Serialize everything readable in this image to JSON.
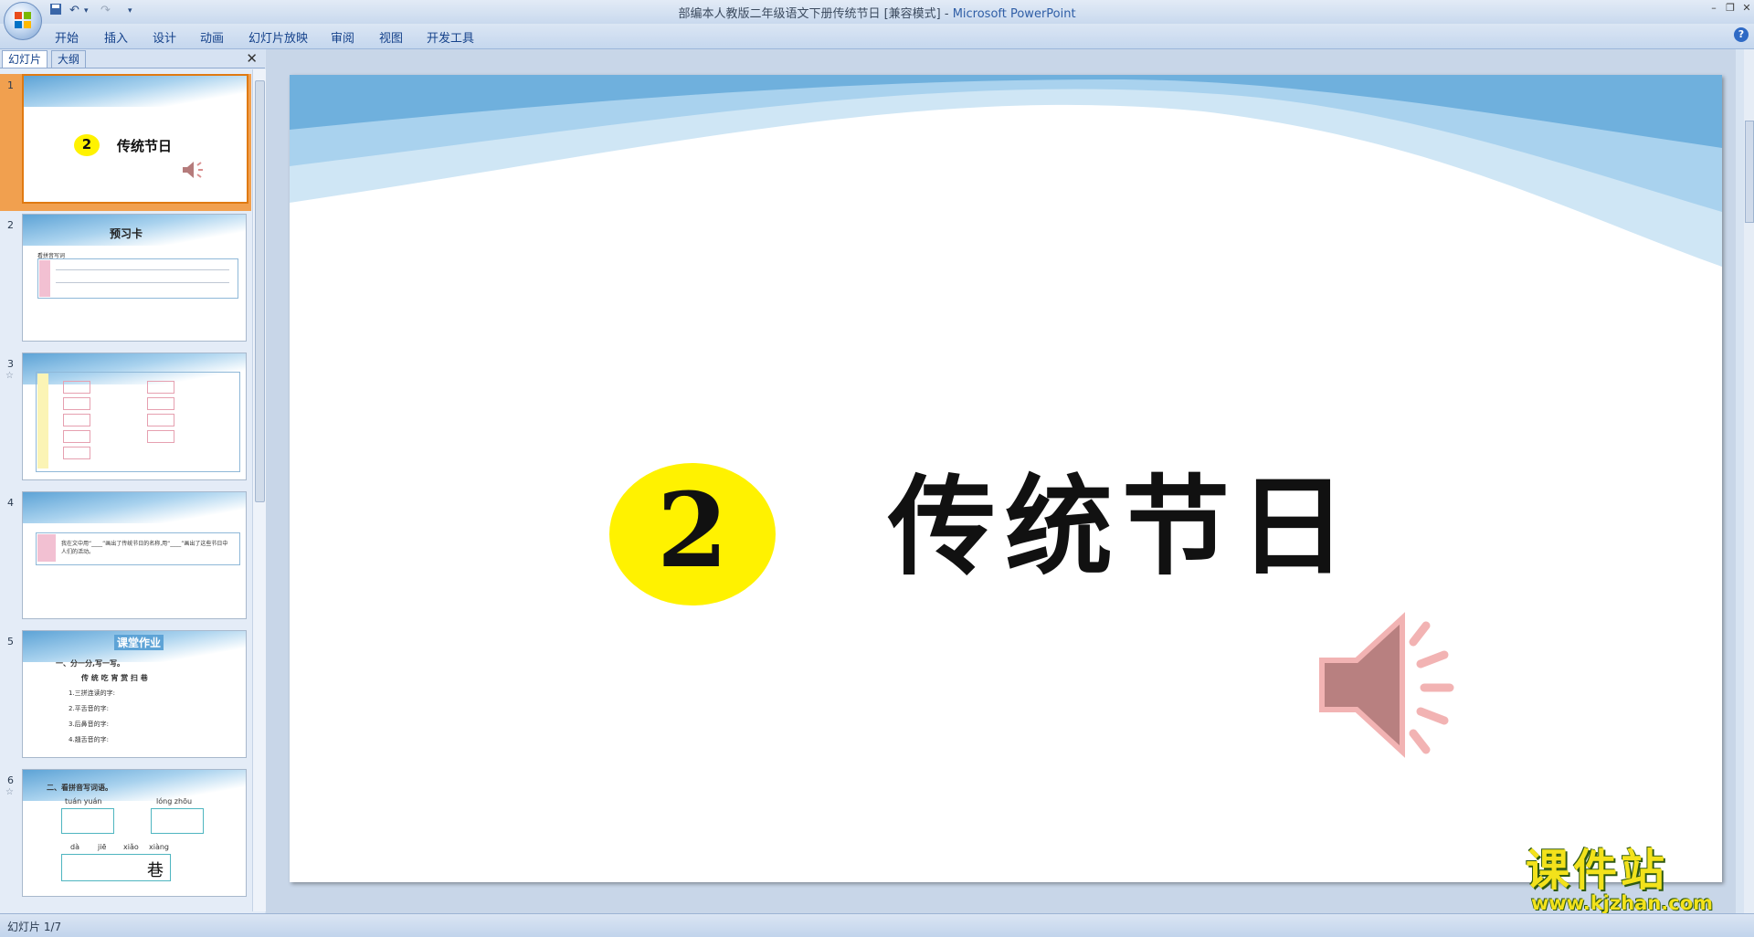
{
  "window": {
    "title_doc": "部编本人教版二年级语文下册传统节日 [兼容模式]",
    "title_sep": " - ",
    "title_app": "Microsoft PowerPoint"
  },
  "ribbon": {
    "tabs": [
      "开始",
      "插入",
      "设计",
      "动画",
      "幻灯片放映",
      "审阅",
      "视图",
      "开发工具"
    ]
  },
  "pane": {
    "tabs": [
      "幻灯片",
      "大纲"
    ],
    "close_glyph": "✕"
  },
  "thumbnails": [
    {
      "num": "1",
      "num_label": "2",
      "title": "传统节日"
    },
    {
      "num": "2",
      "title": "预习卡",
      "sub": "看拼音写词"
    },
    {
      "num": "3",
      "title": "",
      "sub": ""
    },
    {
      "num": "4",
      "text": "我在文中用“____”画出了传统节日的名称,用“____”画出了这些节日中人们的活动。"
    },
    {
      "num": "5",
      "banner": "课堂作业",
      "heading": "一、分一分,写一写。",
      "chars": "传 统 吃 宵 赏 扫 巷",
      "items": [
        "1.三拼连读的字:",
        "2.平舌音的字:",
        "3.后鼻音的字:",
        "4.翘舌音的字:"
      ]
    },
    {
      "num": "6",
      "heading": "二、看拼音写词语。",
      "pinyin": [
        "tuán  yuán",
        "lóng  zhōu",
        "dà",
        "jiē",
        "xiǎo",
        "xiàng"
      ],
      "char": "巷"
    }
  ],
  "slide": {
    "number": "2",
    "title": "传统节日"
  },
  "watermark": {
    "name": "课件站",
    "url": "www.kjzhan.com"
  },
  "status": {
    "slide_counter": "幻灯片 1/7"
  },
  "colors": {
    "accent_yellow": "#fff200",
    "selection_orange": "#f1a04f"
  }
}
